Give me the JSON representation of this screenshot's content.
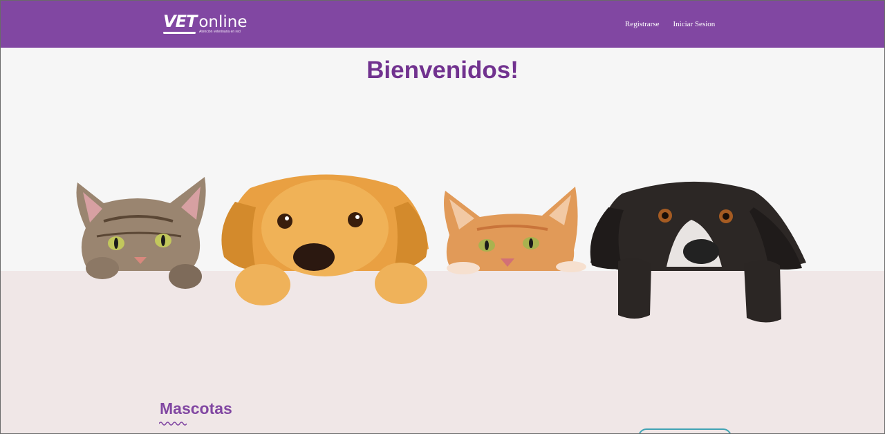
{
  "header": {
    "logo": {
      "vet": "VET",
      "online": "online",
      "tagline": "Atención veterinaria en red"
    },
    "nav": [
      {
        "label": "Registrarse"
      },
      {
        "label": "Iniciar Sesion"
      }
    ]
  },
  "hero": {
    "title": "Bienvenidos!",
    "image": "cats-and-dogs-peeking-over-ledge"
  },
  "section": {
    "title": "Mascotas"
  },
  "colors": {
    "brand_purple": "#8147a2",
    "title_purple": "#71328f",
    "hero_bg": "#f6f6f6",
    "lower_bg": "#f0e7e7",
    "button_teal": "#40a3b4"
  }
}
